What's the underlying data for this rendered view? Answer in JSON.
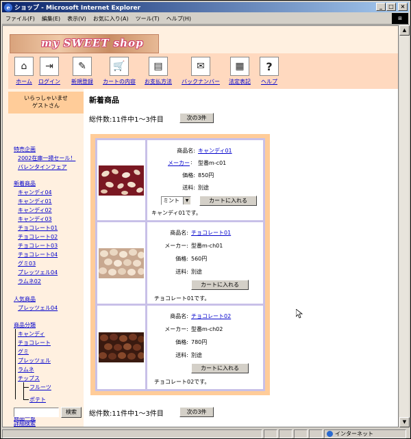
{
  "window": {
    "title": "ショップ - Microsoft Internet Explorer",
    "minimize": "_",
    "maximize": "□",
    "close": "×"
  },
  "menubar": [
    "ファイル(F)",
    "編集(E)",
    "表示(V)",
    "お気に入り(A)",
    "ツール(T)",
    "ヘルプ(H)"
  ],
  "logo": {
    "text": "my SWEET shop"
  },
  "nav": [
    {
      "label": "ホーム",
      "icon": "house-icon",
      "glyph": "⌂"
    },
    {
      "label": "ログイン",
      "icon": "login-door-icon",
      "glyph": "⇥"
    },
    {
      "label": "新規登録",
      "icon": "pen-signup-icon",
      "glyph": "✎"
    },
    {
      "label": "カートの内容",
      "icon": "cart-icon",
      "glyph": "🛒"
    },
    {
      "label": "お支払方法",
      "icon": "payment-icon",
      "glyph": "▤"
    },
    {
      "label": "バックナンバー",
      "icon": "mail-magazine-icon",
      "glyph": "✉"
    },
    {
      "label": "法定表記",
      "icon": "document-icon",
      "glyph": "▦"
    },
    {
      "label": "ヘルプ",
      "icon": "help-icon",
      "glyph": "?"
    }
  ],
  "sidebar": {
    "welcome_line1": "いらっしゃいませ",
    "welcome_line2": "ゲストさん",
    "special_title": "特売企画",
    "special_items": [
      "2002在庫一掃セール！",
      "バレンタインフェア"
    ],
    "new_title": "新着商品",
    "new_items": [
      "キャンディ04",
      "キャンディ01",
      "キャンディ02",
      "キャンディ03",
      "チョコレート01",
      "チョコレート02",
      "チョコレート03",
      "チョコレート04",
      "グミ03",
      "プレッツェル04",
      "ラムネ02"
    ],
    "popular_title": "人気商品",
    "popular_items": [
      "プレッツェル04"
    ],
    "category_title": "商品分類",
    "categories": [
      "キャンディ",
      "チョコレート",
      "グミ",
      "プレッツェル",
      "ラムネ",
      "チップス"
    ],
    "subcategories": [
      "フルーツ",
      "ポテト"
    ],
    "all_products": "商品一覧",
    "search_button": "検索",
    "advanced_search": "詳細検索"
  },
  "main": {
    "heading": "新着商品",
    "count_text": "総件数:11件中1～3件目",
    "next_button": "次の3件"
  },
  "labels": {
    "name": "商品名:",
    "maker": "メーカー",
    "maker_colon": "メーカー:",
    "price": "価格:",
    "shipping": "送料:",
    "cart_button": "カートに入れる"
  },
  "products": [
    {
      "name": "キャンディ01",
      "maker": "型番m-c01",
      "price": "850円",
      "shipping": "別途",
      "option": "ミント",
      "description": "キャンディ01です。"
    },
    {
      "name": "チョコレート01",
      "maker": "型番m-ch01",
      "price": "560円",
      "shipping": "別途",
      "description": "チョコレート01です。"
    },
    {
      "name": "チョコレート02",
      "maker": "型番m-ch02",
      "price": "780円",
      "shipping": "別途",
      "description": "チョコレート02です。"
    }
  ],
  "status": {
    "zone": "インターネット"
  }
}
